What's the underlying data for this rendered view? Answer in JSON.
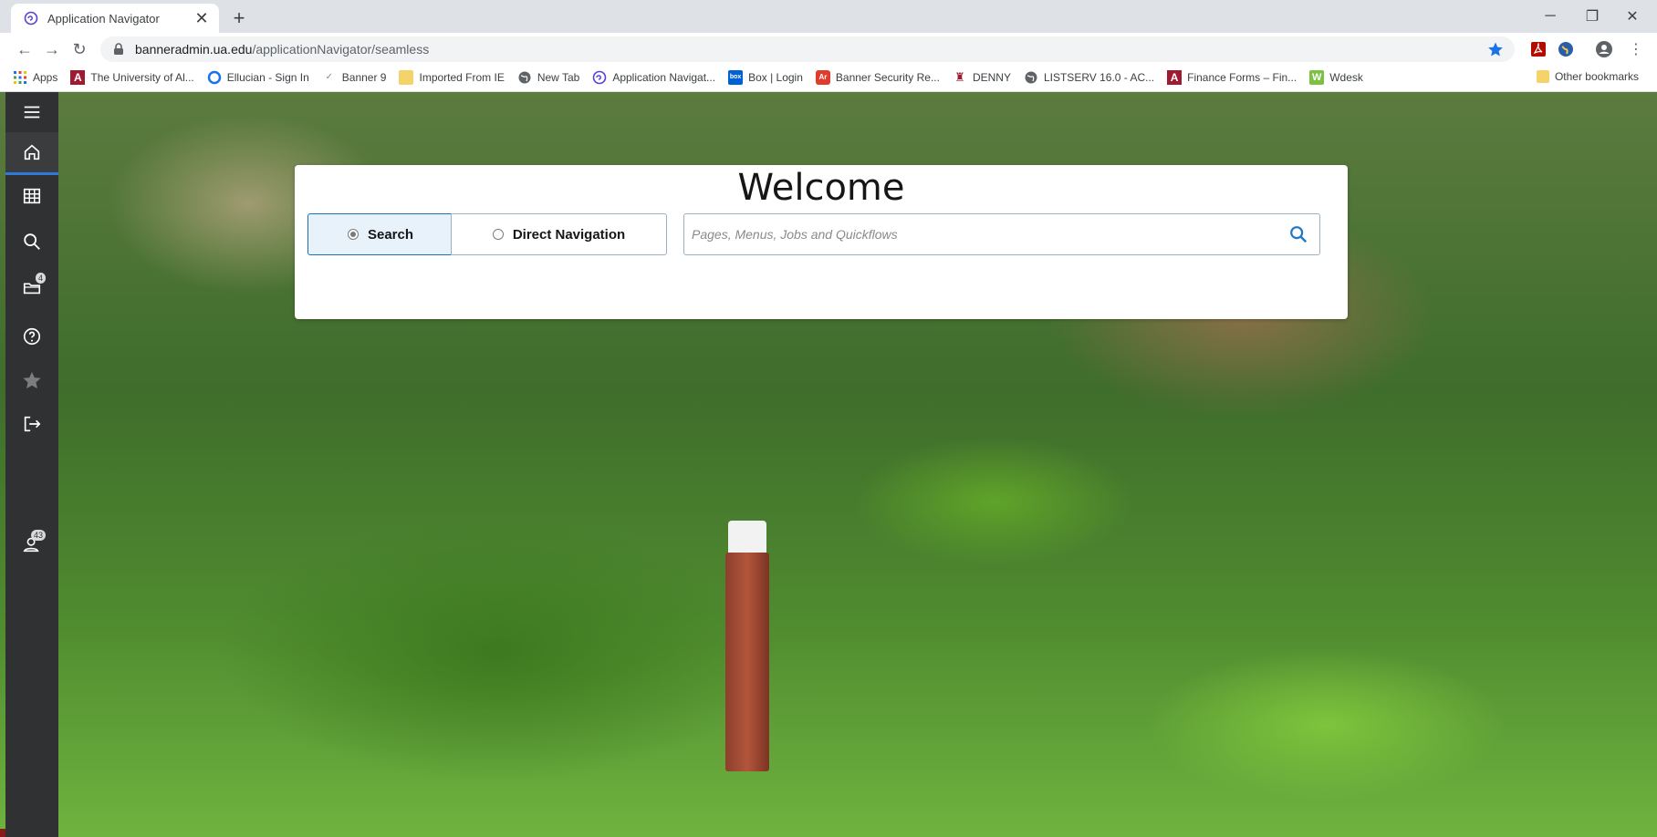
{
  "browser": {
    "tab_title": "Application Navigator",
    "url_host": "banneradmin.ua.edu",
    "url_path": "/applicationNavigator/seamless",
    "bookmarks": [
      {
        "label": "Apps",
        "icon": "apps-grid-icon"
      },
      {
        "label": "The University of Al...",
        "icon": "ua-logo-icon"
      },
      {
        "label": "Ellucian - Sign In",
        "icon": "circle-icon"
      },
      {
        "label": "Banner 9",
        "icon": "banner-icon"
      },
      {
        "label": "Imported From IE",
        "icon": "folder-icon"
      },
      {
        "label": "New Tab",
        "icon": "globe-icon"
      },
      {
        "label": "Application Navigat...",
        "icon": "app-nav-icon"
      },
      {
        "label": "Box | Login",
        "icon": "box-icon"
      },
      {
        "label": "Banner Security Re...",
        "icon": "acrobat-icon"
      },
      {
        "label": "DENNY",
        "icon": "figure-icon"
      },
      {
        "label": "LISTSERV 16.0 - AC...",
        "icon": "globe-icon"
      },
      {
        "label": "Finance Forms – Fin...",
        "icon": "ua-logo-icon"
      },
      {
        "label": "Wdesk",
        "icon": "wdesk-icon"
      }
    ],
    "other_bookmarks": "Other bookmarks"
  },
  "sidebar": {
    "items": [
      {
        "name": "menu",
        "icon": "hamburger-icon"
      },
      {
        "name": "home",
        "icon": "home-icon",
        "active": true
      },
      {
        "name": "applications",
        "icon": "grid-icon"
      },
      {
        "name": "search",
        "icon": "search-icon"
      },
      {
        "name": "recent",
        "icon": "folder-badge-icon",
        "badge": "4"
      },
      {
        "name": "help",
        "icon": "help-icon"
      },
      {
        "name": "favorites",
        "icon": "star-icon"
      },
      {
        "name": "sign-out",
        "icon": "sign-out-icon"
      },
      {
        "name": "notifications",
        "icon": "user-badge-icon",
        "badge": "43"
      }
    ]
  },
  "welcome": {
    "title": "Welcome",
    "search_label": "Search",
    "direct_label": "Direct Navigation",
    "search_placeholder": "Pages, Menus, Jobs and Quickflows"
  },
  "colors": {
    "sidebar_bg": "#2f3133",
    "accent": "#2f7ad9",
    "card_bg": "#ffffff"
  }
}
